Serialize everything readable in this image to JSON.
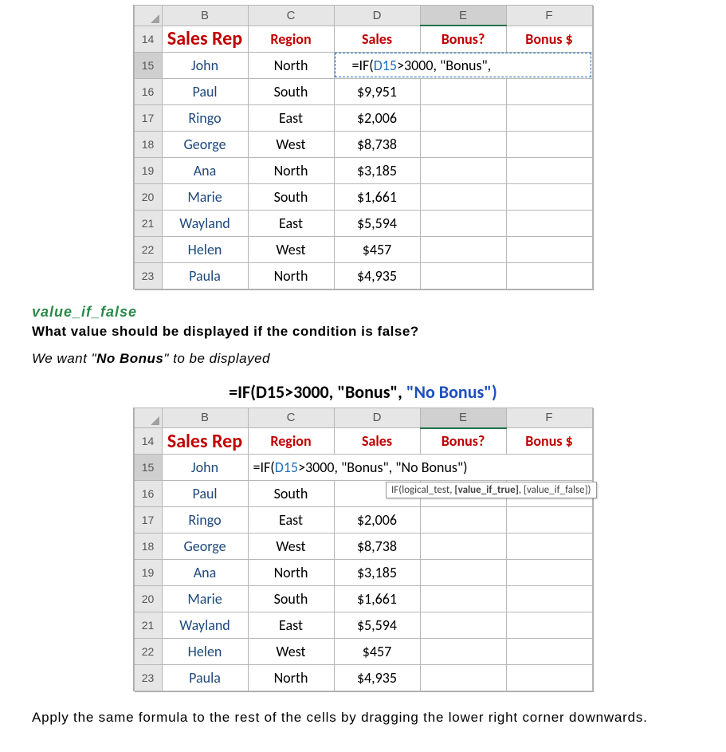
{
  "table1": {
    "cols": [
      "B",
      "C",
      "D",
      "E",
      "F"
    ],
    "row_start": 14,
    "headers": {
      "B": "Sales Rep",
      "C": "Region",
      "D": "Sales",
      "E": "Bonus?",
      "F": "Bonus $"
    },
    "formula_row": 15,
    "formula_prefix": "=IF(",
    "formula_ref": "D15",
    "formula_suffix": ">3000, \"Bonus\",",
    "rows": [
      {
        "n": 15,
        "rep": "John",
        "region": "North",
        "sales": ""
      },
      {
        "n": 16,
        "rep": "Paul",
        "region": "South",
        "sales": "$9,951"
      },
      {
        "n": 17,
        "rep": "Ringo",
        "region": "East",
        "sales": "$2,006"
      },
      {
        "n": 18,
        "rep": "George",
        "region": "West",
        "sales": "$8,738"
      },
      {
        "n": 19,
        "rep": "Ana",
        "region": "North",
        "sales": "$3,185"
      },
      {
        "n": 20,
        "rep": "Marie",
        "region": "South",
        "sales": "$1,661"
      },
      {
        "n": 21,
        "rep": "Wayland",
        "region": "East",
        "sales": "$5,594"
      },
      {
        "n": 22,
        "rep": "Helen",
        "region": "West",
        "sales": "$457"
      },
      {
        "n": 23,
        "rep": "Paula",
        "region": "North",
        "sales": "$4,935"
      }
    ]
  },
  "mid": {
    "subhead": "value_if_false",
    "question": "What value should be displayed if the condition is false?",
    "italic_pre": "We want \"",
    "italic_bold": "No Bonus",
    "italic_post": "\" to be displayed",
    "formula_plain": "=IF(D15>3000, \"Bonus\", ",
    "formula_blue": "\"No Bonus\")"
  },
  "table2": {
    "cols": [
      "B",
      "C",
      "D",
      "E",
      "F"
    ],
    "row_start": 14,
    "headers": {
      "B": "Sales Rep",
      "C": "Region",
      "D": "Sales",
      "E": "Bonus?",
      "F": "Bonus $"
    },
    "formula_row": 15,
    "formula_prefix": "=IF(",
    "formula_ref": "D15",
    "formula_suffix": ">3000, \"Bonus\", \"No Bonus\")",
    "tooltip": "IF(logical_test, [value_if_true], [value_if_false])",
    "rows": [
      {
        "n": 15,
        "rep": "John",
        "region": "",
        "sales": ""
      },
      {
        "n": 16,
        "rep": "Paul",
        "region": "South",
        "sales": ""
      },
      {
        "n": 17,
        "rep": "Ringo",
        "region": "East",
        "sales": "$2,006"
      },
      {
        "n": 18,
        "rep": "George",
        "region": "West",
        "sales": "$8,738"
      },
      {
        "n": 19,
        "rep": "Ana",
        "region": "North",
        "sales": "$3,185"
      },
      {
        "n": 20,
        "rep": "Marie",
        "region": "South",
        "sales": "$1,661"
      },
      {
        "n": 21,
        "rep": "Wayland",
        "region": "East",
        "sales": "$5,594"
      },
      {
        "n": 22,
        "rep": "Helen",
        "region": "West",
        "sales": "$457"
      },
      {
        "n": 23,
        "rep": "Paula",
        "region": "North",
        "sales": "$4,935"
      }
    ]
  },
  "after": "Apply the same formula to the rest of the cells by dragging the lower right corner downwards."
}
